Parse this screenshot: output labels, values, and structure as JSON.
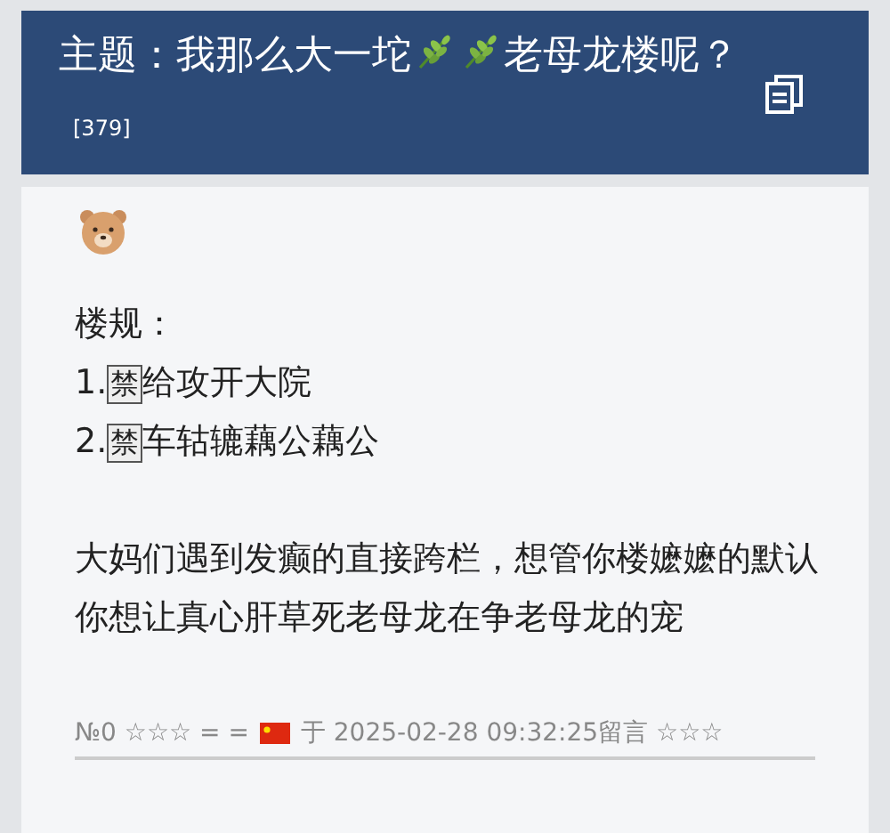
{
  "header": {
    "title_before": "主题：我那么大一坨",
    "title_after": "老母龙楼呢？",
    "reply_count": "[379]"
  },
  "post": {
    "heading": "楼规：",
    "rules": [
      {
        "number": "1.",
        "mark": "禁",
        "text": "给攻开大院"
      },
      {
        "number": "2.",
        "mark": "禁",
        "text": "车轱辘藕公藕公"
      }
    ],
    "body": "大妈们遇到发癫的直接跨栏，想管你楼嬷嬷的默认你想让真心肝草死老母龙在争老母龙的宠",
    "meta_before": "№0 ☆☆☆ = =",
    "meta_after": "于 2025-02-28 09:32:25留言 ☆☆☆"
  }
}
